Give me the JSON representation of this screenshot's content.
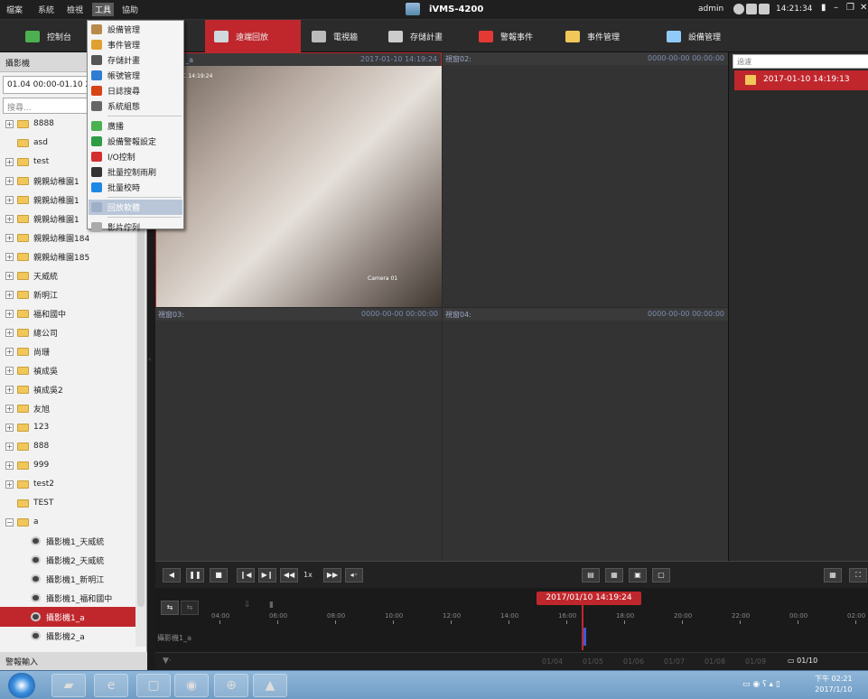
{
  "menubar": {
    "items": [
      "檔案",
      "系統",
      "檢視",
      "工具",
      "協助"
    ],
    "active": "工具",
    "app_title": "iVMS-4200",
    "user": "admin",
    "clock": "14:21:34"
  },
  "modules": [
    {
      "label": "控制台",
      "color": "#4caf50"
    },
    {
      "label": "遠端回放",
      "color": "#cfd8dc"
    },
    {
      "label": "電視牆",
      "color": "#bbb"
    },
    {
      "label": "存儲計畫",
      "color": "#ccc"
    },
    {
      "label": "警報事件",
      "color": "#e53935"
    },
    {
      "label": "事件管理",
      "color": "#f1c75a"
    },
    {
      "label": "設備管理",
      "color": "#90caf9"
    }
  ],
  "left_panel": {
    "header": "攝影機",
    "date_range": "01.04 00:00-01.10 2",
    "search_placeholder": "搜尋...",
    "tree": [
      {
        "label": "8888",
        "type": "group",
        "expander": "+"
      },
      {
        "label": "asd",
        "type": "group",
        "expander": ""
      },
      {
        "label": "test",
        "type": "group",
        "expander": "+"
      },
      {
        "label": "親親幼稚園1",
        "type": "group",
        "expander": "+"
      },
      {
        "label": "親親幼稚園1",
        "type": "group",
        "expander": "+"
      },
      {
        "label": "親親幼稚園1",
        "type": "group",
        "expander": "+"
      },
      {
        "label": "親親幼稚園184",
        "type": "group",
        "expander": "+"
      },
      {
        "label": "親親幼稚園185",
        "type": "group",
        "expander": "+"
      },
      {
        "label": "天威統",
        "type": "group",
        "expander": "+"
      },
      {
        "label": "新明江",
        "type": "group",
        "expander": "+"
      },
      {
        "label": "福和國中",
        "type": "group",
        "expander": "+"
      },
      {
        "label": "總公司",
        "type": "group",
        "expander": "+"
      },
      {
        "label": "尚珊",
        "type": "group",
        "expander": "+"
      },
      {
        "label": "禎成吳",
        "type": "group",
        "expander": "+"
      },
      {
        "label": "禎成吳2",
        "type": "group",
        "expander": "+"
      },
      {
        "label": "友旭",
        "type": "group",
        "expander": "+"
      },
      {
        "label": "123",
        "type": "group",
        "expander": "+"
      },
      {
        "label": "888",
        "type": "group",
        "expander": "+"
      },
      {
        "label": "999",
        "type": "group",
        "expander": "+"
      },
      {
        "label": "test2",
        "type": "group",
        "expander": "+"
      },
      {
        "label": "TEST",
        "type": "group",
        "expander": ""
      },
      {
        "label": "a",
        "type": "group",
        "expander": "−"
      },
      {
        "label": "攝影機1_天威統",
        "type": "camera",
        "expander": ""
      },
      {
        "label": "攝影機2_天威統",
        "type": "camera",
        "expander": ""
      },
      {
        "label": "攝影機1_新明江",
        "type": "camera",
        "expander": ""
      },
      {
        "label": "攝影機1_福和國中",
        "type": "camera",
        "expander": ""
      },
      {
        "label": "攝影機1_a",
        "type": "camera",
        "expander": "",
        "selected": true
      },
      {
        "label": "攝影機2_a",
        "type": "camera",
        "expander": ""
      }
    ],
    "footer": "警報輸入"
  },
  "tools_menu": [
    {
      "label": "設備管理",
      "icon": "device-icon",
      "color": "#b88a4a"
    },
    {
      "label": "事件管理",
      "icon": "event-icon",
      "color": "#e0a030"
    },
    {
      "label": "存儲計畫",
      "icon": "storage-icon",
      "color": "#555"
    },
    {
      "label": "帳號管理",
      "icon": "account-icon",
      "color": "#2e7dd1"
    },
    {
      "label": "日誌搜尋",
      "icon": "log-icon",
      "color": "#d84315"
    },
    {
      "label": "系統組態",
      "icon": "system-config-icon",
      "color": "#666"
    },
    {
      "sep": true
    },
    {
      "label": "廣播",
      "icon": "broadcast-icon",
      "color": "#4caf50"
    },
    {
      "label": "設備警報設定",
      "icon": "alarm-setting-icon",
      "color": "#2e9d46"
    },
    {
      "label": "I/O控制",
      "icon": "io-icon",
      "color": "#d32f2f"
    },
    {
      "label": "批量控制雨刷",
      "icon": "wiper-icon",
      "color": "#333"
    },
    {
      "label": "批量校時",
      "icon": "time-sync-icon",
      "color": "#1e88e5"
    },
    {
      "sep": true
    },
    {
      "label": "回放軟體",
      "icon": "player-icon",
      "color": "#9db0c8",
      "highlight": true
    },
    {
      "sep": true
    },
    {
      "label": "影片佇列",
      "icon": "queue-icon",
      "color": "#aaa"
    }
  ],
  "video": {
    "windows": [
      {
        "title": "攝影機1_a",
        "timestamp": "2017-01-10 14:19:24",
        "selected": true
      },
      {
        "title": "視窗02:",
        "timestamp": "0000-00-00 00:00:00",
        "selected": false
      },
      {
        "title": "視窗03:",
        "timestamp": "0000-00-00 00:00:00",
        "selected": false
      },
      {
        "title": "視窗04:",
        "timestamp": "0000-00-00 00:00:00",
        "selected": false
      }
    ],
    "osd_time": "10 星期二 14:19:24",
    "osd_camera": "Camera 01"
  },
  "right_panel": {
    "filter_placeholder": "過濾",
    "files": [
      "2017-01-10 14:19:13"
    ]
  },
  "controls": {
    "speed": "1x"
  },
  "timeline": {
    "current_time": "2017/01/10 14:19:24",
    "ticks": [
      "04:00",
      "06:00",
      "08:00",
      "10:00",
      "12:00",
      "14:00",
      "16:00",
      "18:00",
      "20:00",
      "22:00",
      "00:00",
      "02:00"
    ],
    "track_label": "攝影機1_a",
    "dates": [
      "01/04",
      "01/05",
      "01/06",
      "01/07",
      "01/08",
      "01/09"
    ],
    "current_date": "01/10"
  },
  "taskbar": {
    "time": "下午 02:21",
    "date": "2017/1/10"
  }
}
